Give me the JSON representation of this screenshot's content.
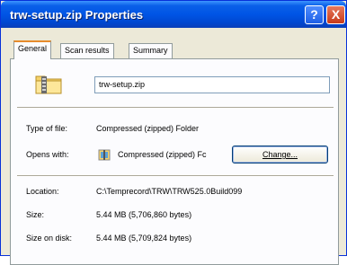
{
  "window": {
    "title": "trw-setup.zip Properties",
    "help_label": "?",
    "close_label": "X"
  },
  "tabs": [
    {
      "label": "General",
      "active": true
    },
    {
      "label": "Scan results",
      "active": false
    },
    {
      "label": "Summary",
      "active": false
    }
  ],
  "general": {
    "file_name": "trw-setup.zip",
    "type_label": "Type of file:",
    "type_value": "Compressed (zipped) Folder",
    "opens_label": "Opens with:",
    "opens_value": "Compressed (zipped) Fc",
    "change_button": "Change...",
    "location_label": "Location:",
    "location_value": "C:\\Temprecord\\TRW\\TRW525.0Build099",
    "size_label": "Size:",
    "size_value": "5.44 MB (5,706,860 bytes)",
    "size_on_disk_label": "Size on disk:",
    "size_on_disk_value": "5.44 MB (5,709,824 bytes)"
  },
  "colors": {
    "titlebar": "#0055e5",
    "active_tab_accent": "#e68b2c",
    "window_bg": "#ece9d8"
  },
  "icons": {
    "folder": "zip-folder-icon",
    "opens_with": "compressed-folder-app-icon",
    "help": "help-icon",
    "close": "close-icon"
  }
}
